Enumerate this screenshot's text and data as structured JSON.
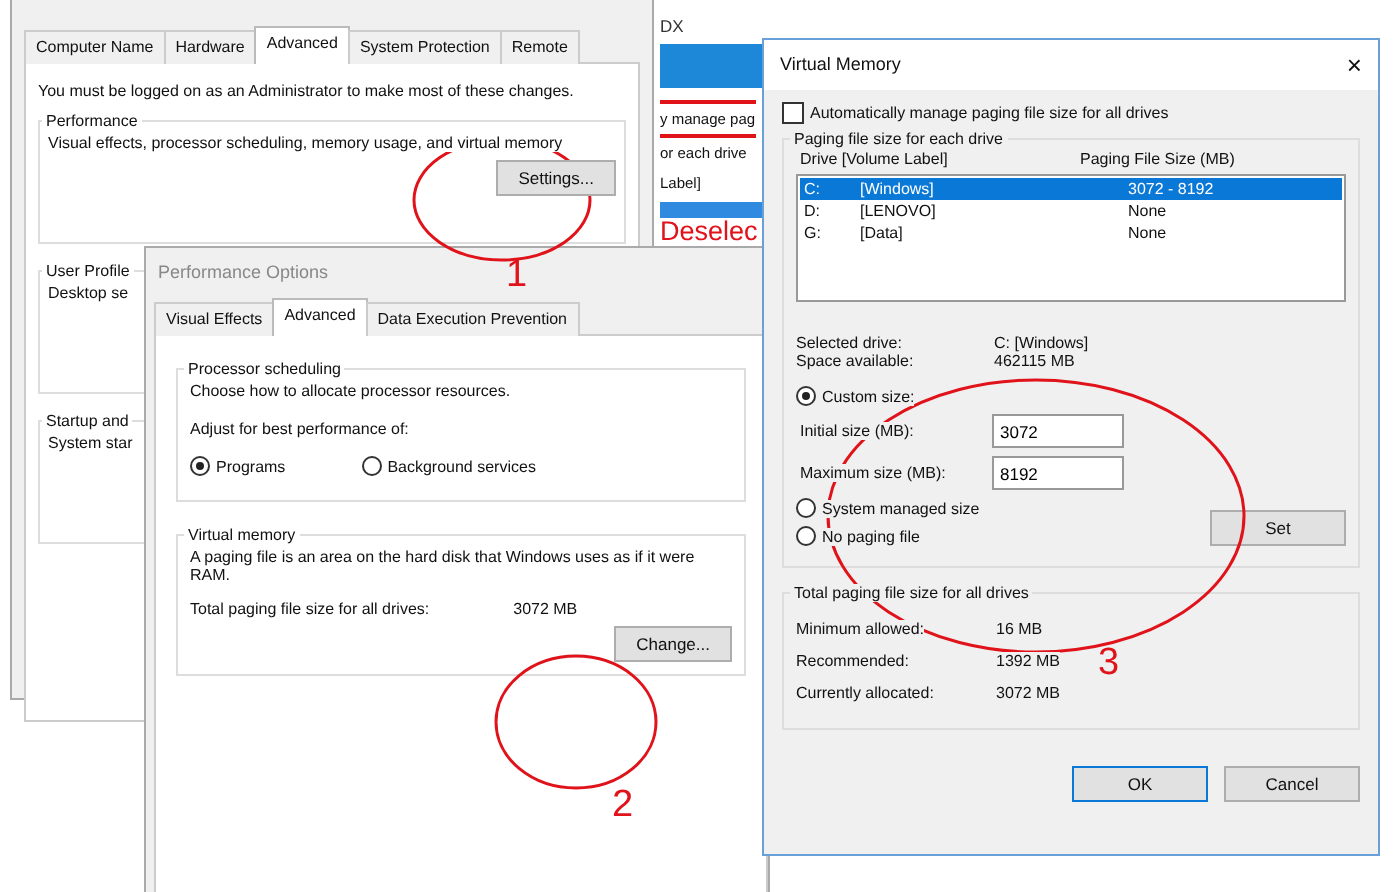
{
  "system_properties": {
    "tabs": [
      {
        "label": "Computer Name",
        "selected": false
      },
      {
        "label": "Hardware",
        "selected": false
      },
      {
        "label": "Advanced",
        "selected": true
      },
      {
        "label": "System Protection",
        "selected": false
      },
      {
        "label": "Remote",
        "selected": false
      }
    ],
    "notice": "You must be logged on as an Administrator to make most of these changes.",
    "groups": [
      {
        "title": "Performance",
        "text": "Visual effects, processor scheduling, memory usage, and virtual memory",
        "button": "Settings..."
      },
      {
        "title": "User Profile",
        "text": "Desktop se"
      },
      {
        "title": "Startup and",
        "text": "System star"
      }
    ]
  },
  "background_window": {
    "title": "DX",
    "texts": [
      "y manage pag",
      "or each drive",
      "Label]"
    ],
    "overlay_text": "Deselec"
  },
  "performance_options": {
    "title": "Performance Options",
    "tabs": [
      {
        "label": "Visual Effects",
        "selected": false
      },
      {
        "label": "Advanced",
        "selected": true
      },
      {
        "label": "Data Execution Prevention",
        "selected": false
      }
    ],
    "processor_scheduling": {
      "title": "Processor scheduling",
      "description": "Choose how to allocate processor resources.",
      "prompt": "Adjust for best performance of:",
      "options": [
        {
          "label": "Programs",
          "selected": true
        },
        {
          "label": "Background services",
          "selected": false
        }
      ]
    },
    "virtual_memory": {
      "title": "Virtual memory",
      "description": "A paging file is an area on the hard disk that Windows uses as if it were RAM.",
      "total_label": "Total paging file size for all drives:",
      "total_value": "3072 MB",
      "button": "Change..."
    }
  },
  "virtual_memory": {
    "title": "Virtual Memory",
    "close": "×",
    "auto_manage": {
      "label": "Automatically manage paging file size for all drives",
      "checked": false
    },
    "drives_group": {
      "title": "Paging file size for each drive",
      "columns": [
        "Drive  [Volume Label]",
        "Paging File Size (MB)"
      ],
      "rows": [
        {
          "drive": "C:",
          "label": "[Windows]",
          "size": "3072 - 8192",
          "selected": true
        },
        {
          "drive": "D:",
          "label": "[LENOVO]",
          "size": "None",
          "selected": false
        },
        {
          "drive": "G:",
          "label": "[Data]",
          "size": "None",
          "selected": false
        }
      ],
      "info": [
        {
          "label": "Selected drive:",
          "value": "C:  [Windows]"
        },
        {
          "label": "Space available:",
          "value": "462115 MB"
        }
      ],
      "size_options": [
        {
          "label": "Custom size:",
          "selected": true
        },
        {
          "label": "System managed size",
          "selected": false
        },
        {
          "label": "No paging file",
          "selected": false
        }
      ],
      "fields": [
        {
          "label": "Initial size (MB):",
          "value": "3072"
        },
        {
          "label": "Maximum size (MB):",
          "value": "8192"
        }
      ],
      "set_button": "Set"
    },
    "totals_group": {
      "title": "Total paging file size for all drives",
      "rows": [
        {
          "label": "Minimum allowed:",
          "value": "16 MB"
        },
        {
          "label": "Recommended:",
          "value": "1392 MB"
        },
        {
          "label": "Currently allocated:",
          "value": "3072 MB"
        }
      ]
    },
    "buttons": [
      {
        "label": "OK",
        "default": true
      },
      {
        "label": "Cancel",
        "default": false
      }
    ]
  },
  "annotations": [
    {
      "label": "1"
    },
    {
      "label": "2"
    },
    {
      "label": "3"
    }
  ]
}
